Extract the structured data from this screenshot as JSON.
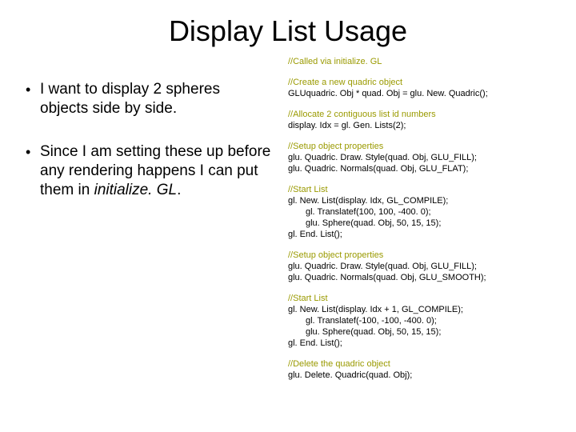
{
  "title": "Display List Usage",
  "bullets": [
    {
      "dot": "•",
      "text": "I want to display 2 spheres objects side by side."
    },
    {
      "dot": "•",
      "text_pre": "Since I am setting these up before any rendering happens I can put them in ",
      "text_em": "initialize. GL",
      "text_post": "."
    }
  ],
  "code": {
    "c0": "//Called via initialize. GL",
    "c1": "//Create a new quadric object",
    "l1": "GLUquadric. Obj * quad. Obj = glu. New. Quadric();",
    "c2": "//Allocate 2 contiguous list id numbers",
    "l2": "display. Idx = gl. Gen. Lists(2);",
    "c3": "//Setup object properties",
    "l3a": "glu. Quadric. Draw. Style(quad. Obj, GLU_FILL);",
    "l3b": "glu. Quadric. Normals(quad. Obj, GLU_FLAT);",
    "c4": "//Start List",
    "l4a": "gl. New. List(display. Idx, GL_COMPILE);",
    "l4b": "gl. Translatef(100, 100, -400. 0);",
    "l4c": "glu. Sphere(quad. Obj, 50, 15, 15);",
    "l4d": "gl. End. List();",
    "c5": "//Setup object properties",
    "l5a": "glu. Quadric. Draw. Style(quad. Obj, GLU_FILL);",
    "l5b": "glu. Quadric. Normals(quad. Obj, GLU_SMOOTH);",
    "c6": "//Start List",
    "l6a": "gl. New. List(display. Idx + 1, GL_COMPILE);",
    "l6b": "gl. Translatef(-100, -100, -400. 0);",
    "l6c": "glu. Sphere(quad. Obj, 50, 15, 15);",
    "l6d": "gl. End. List();",
    "c7": "//Delete the quadric object",
    "l7": "glu. Delete. Quadric(quad. Obj);"
  }
}
